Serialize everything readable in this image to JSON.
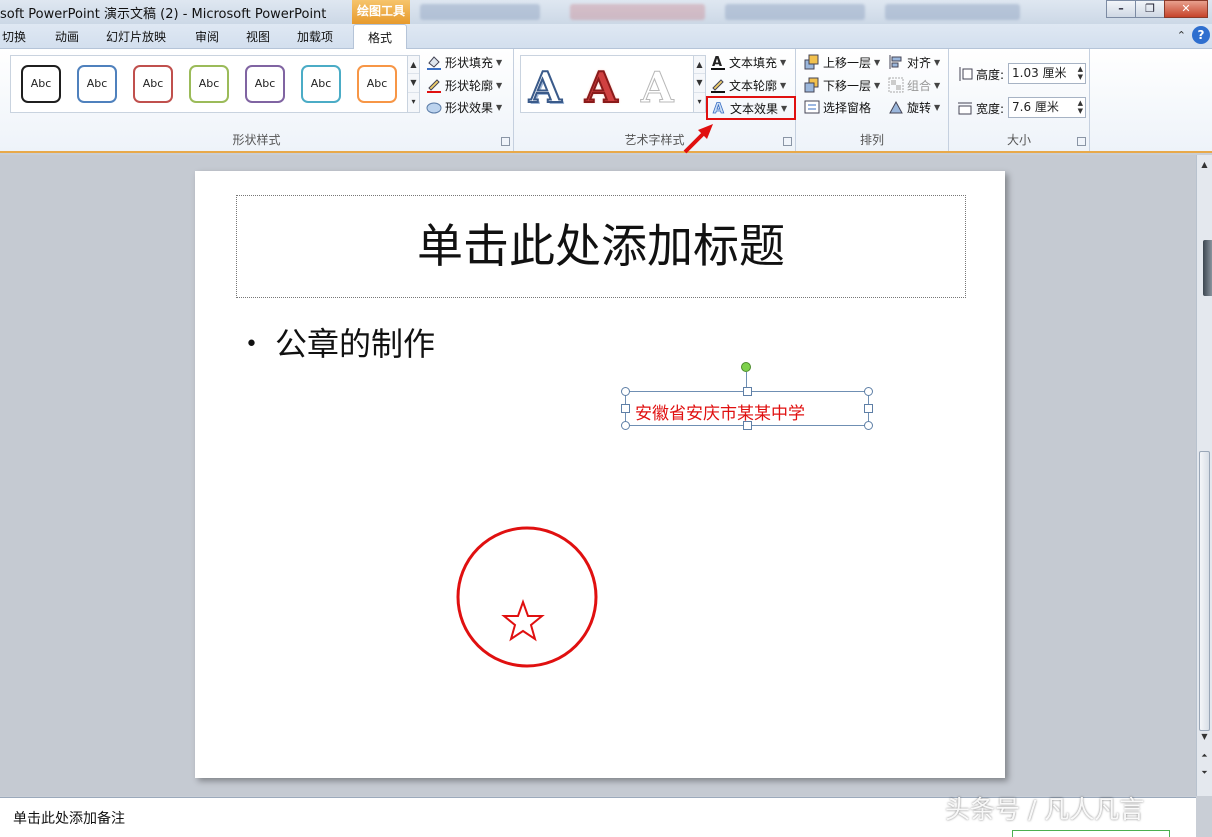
{
  "titlebar": {
    "title": "soft PowerPoint 演示文稿 (2) - Microsoft PowerPoint",
    "context_tab": "绘图工具"
  },
  "tabs": [
    {
      "label": "切换"
    },
    {
      "label": "动画"
    },
    {
      "label": "幻灯片放映"
    },
    {
      "label": "审阅"
    },
    {
      "label": "视图"
    },
    {
      "label": "加载项"
    },
    {
      "label": "格式",
      "active": true
    }
  ],
  "ribbon": {
    "shape_styles": {
      "label": "形状样式",
      "presets": [
        {
          "text": "Abc",
          "color": "#1f1f1f"
        },
        {
          "text": "Abc",
          "color": "#4f81bd"
        },
        {
          "text": "Abc",
          "color": "#c0504d"
        },
        {
          "text": "Abc",
          "color": "#9bbb59"
        },
        {
          "text": "Abc",
          "color": "#8064a2"
        },
        {
          "text": "Abc",
          "color": "#4bacc6"
        },
        {
          "text": "Abc",
          "color": "#f79646"
        }
      ],
      "fill": "形状填充",
      "outline": "形状轮廓",
      "effects": "形状效果"
    },
    "wordart_styles": {
      "label": "艺术字样式",
      "text_fill": "文本填充",
      "text_outline": "文本轮廓",
      "text_effects": "文本效果",
      "sample_letter": "A"
    },
    "arrange": {
      "label": "排列",
      "bring_forward": "上移一层",
      "send_backward": "下移一层",
      "selection_pane": "选择窗格",
      "align": "对齐",
      "group": "组合",
      "rotate": "旋转"
    },
    "size": {
      "label": "大小",
      "height_label": "高度:",
      "height_value": "1.03 厘米",
      "width_label": "宽度:",
      "width_value": "7.6 厘米"
    }
  },
  "slide": {
    "title_placeholder": "单击此处添加标题",
    "bullet_text": "公章的制作",
    "textbox_text": "安徽省安庆市某某中学",
    "stamp_color": "#e01010"
  },
  "notes": {
    "placeholder": "单击此处添加备注"
  },
  "watermark": "头条号 / 凡人凡言"
}
